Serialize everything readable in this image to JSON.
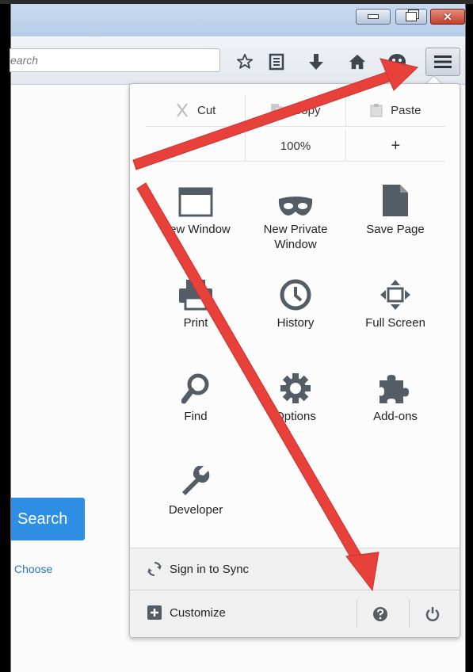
{
  "toolbar": {
    "search_placeholder": "earch"
  },
  "page": {
    "search_button": "Search",
    "choose_link": "Choose"
  },
  "menu": {
    "edit": {
      "cut": "Cut",
      "copy": "Copy",
      "paste": "Paste"
    },
    "zoom": {
      "minus": "−",
      "level": "100%",
      "plus": "+"
    },
    "items": [
      {
        "label": "New Window",
        "icon": "window-icon"
      },
      {
        "label": "New Private\nWindow",
        "icon": "mask-icon"
      },
      {
        "label": "Save Page",
        "icon": "page-icon"
      },
      {
        "label": "Print",
        "icon": "printer-icon"
      },
      {
        "label": "History",
        "icon": "clock-icon"
      },
      {
        "label": "Full Screen",
        "icon": "fullscreen-icon"
      },
      {
        "label": "Find",
        "icon": "magnifier-icon"
      },
      {
        "label": "Options",
        "icon": "gear-icon"
      },
      {
        "label": "Add-ons",
        "icon": "puzzle-icon"
      },
      {
        "label": "Developer",
        "icon": "wrench-icon"
      }
    ],
    "sync": "Sign in to Sync",
    "customize": "Customize"
  },
  "colors": {
    "arrow": "#e8403a",
    "accent_blue": "#2d8ee3",
    "icon_gray": "#545c66"
  }
}
